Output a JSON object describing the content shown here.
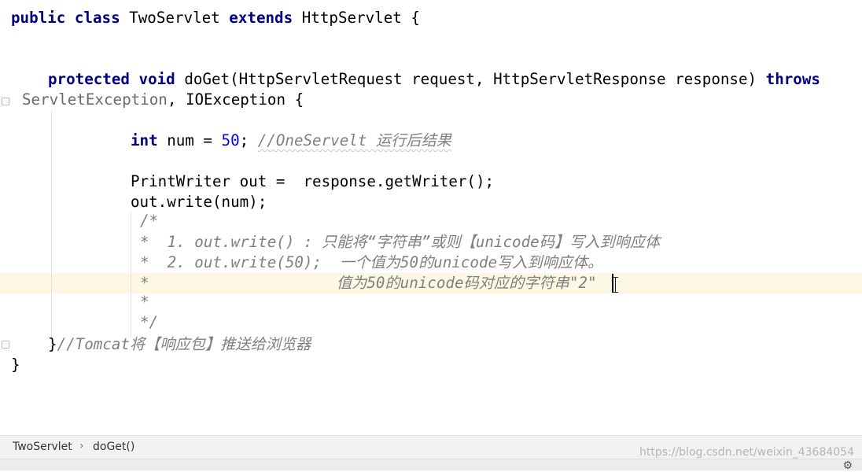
{
  "code": {
    "l1": {
      "kw1": "public",
      "kw2": "class",
      "name": "TwoServlet",
      "kw3": "extends",
      "parent": "HttpServlet",
      "brace": "{"
    },
    "l2": {
      "kw1": "protected",
      "kw2": "void",
      "method": "doGet(HttpServletRequest request, HttpServletResponse response)",
      "kw3": "throws"
    },
    "l3": {
      "ex1": "ServletException",
      "rest": ", IOException {"
    },
    "l4": {
      "kw": "int",
      "pre": " num = ",
      "num": "50",
      "semi": "; ",
      "cmt": "//OneServelt 运行后结果"
    },
    "l5": {
      "text": "PrintWriter out =  response.getWriter();"
    },
    "l6": {
      "text": "out.write(num);"
    },
    "c1": "/*",
    "c2": "*  1. out.write() : 只能将“字符串”或则【unicode码】写入到响应体",
    "c3": "*  2. out.write(50);  一个值为50的unicode写入到响应体。",
    "c4a": "*",
    "c4b": "值为50的unicode码对应的字符串\"2\"",
    "c5": "*",
    "c6": "*/",
    "l7": {
      "brace": "}",
      "cmt": "//Tomcat将【响应包】推送给浏览器"
    },
    "l8": "}"
  },
  "breadcrumb": {
    "class": "TwoServlet",
    "sep": "›",
    "method": "doGet()"
  },
  "watermark": "https://blog.csdn.net/weixin_43684054",
  "icons": {
    "settings": "gear-icon"
  }
}
